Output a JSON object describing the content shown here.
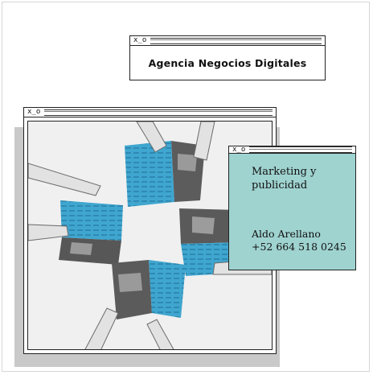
{
  "agency_window": {
    "controls": "x_o",
    "title": "Agencia Negocios Digitales"
  },
  "photo_window": {
    "controls": "x_o",
    "photo": "hands holding blue printed magazines arranged in a cross pattern"
  },
  "marketing_window": {
    "controls": "x_o",
    "service": "Marketing y publicidad",
    "name": "Aldo Arellano",
    "phone": "+52 664 518 0245"
  },
  "colors": {
    "card_background": "#9fd3d0",
    "magazine_blue": "#3fa6cf",
    "border": "#222222",
    "shadow": "#c9c9c9"
  }
}
